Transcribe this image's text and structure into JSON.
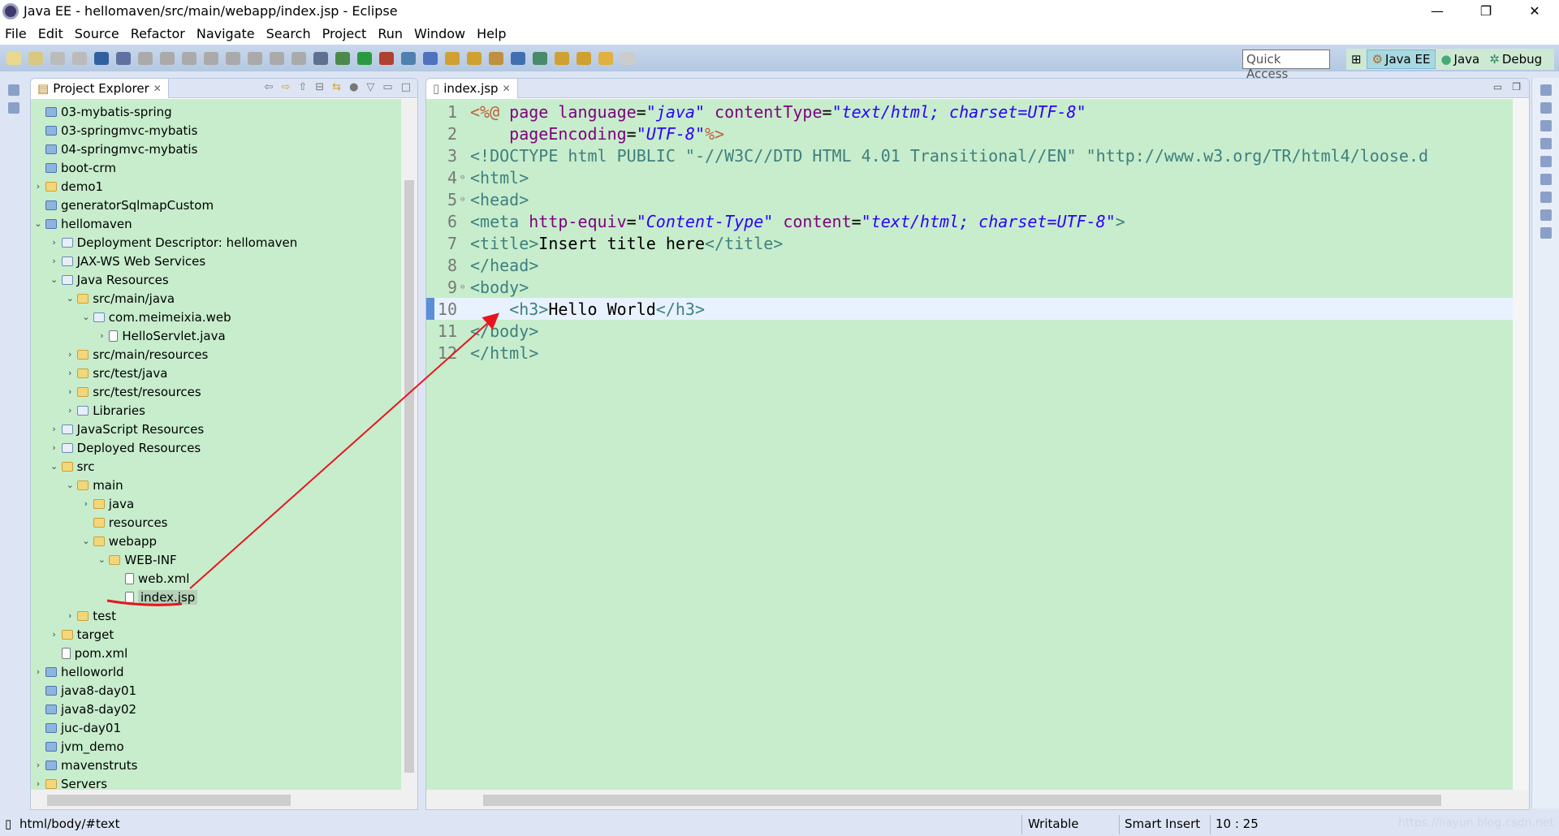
{
  "window": {
    "title": "Java EE - hellomaven/src/main/webapp/index.jsp - Eclipse",
    "controls": [
      "—",
      "❐",
      "✕"
    ]
  },
  "menu": [
    "File",
    "Edit",
    "Source",
    "Refactor",
    "Navigate",
    "Search",
    "Project",
    "Run",
    "Window",
    "Help"
  ],
  "toolbar": {
    "quick_access_placeholder": "Quick Access",
    "perspectives": [
      {
        "label": "Java EE",
        "active": true
      },
      {
        "label": "Java",
        "active": false
      },
      {
        "label": "Debug",
        "active": false
      }
    ]
  },
  "explorer": {
    "title": "Project Explorer",
    "items": [
      {
        "label": "03-mybatis-spring",
        "level": 0,
        "state": "none",
        "icon": "project-folder"
      },
      {
        "label": "03-springmvc-mybatis",
        "level": 0,
        "state": "none",
        "icon": "project-folder"
      },
      {
        "label": "04-springmvc-mybatis",
        "level": 0,
        "state": "none",
        "icon": "project-folder"
      },
      {
        "label": "boot-crm",
        "level": 0,
        "state": "none",
        "icon": "project-folder"
      },
      {
        "label": "demo1",
        "level": 0,
        "state": "collapsed",
        "icon": "folder"
      },
      {
        "label": "generatorSqlmapCustom",
        "level": 0,
        "state": "none",
        "icon": "project-folder"
      },
      {
        "label": "hellomaven",
        "level": 0,
        "state": "expanded",
        "icon": "project"
      },
      {
        "label": "Deployment Descriptor: hellomaven",
        "level": 1,
        "state": "collapsed",
        "icon": "descriptor"
      },
      {
        "label": "JAX-WS Web Services",
        "level": 1,
        "state": "collapsed",
        "icon": "web-services"
      },
      {
        "label": "Java Resources",
        "level": 1,
        "state": "expanded",
        "icon": "java-resources"
      },
      {
        "label": "src/main/java",
        "level": 2,
        "state": "expanded",
        "icon": "source-folder"
      },
      {
        "label": "com.meimeixia.web",
        "level": 3,
        "state": "expanded",
        "icon": "package"
      },
      {
        "label": "HelloServlet.java",
        "level": 4,
        "state": "collapsed",
        "icon": "java-file"
      },
      {
        "label": "src/main/resources",
        "level": 2,
        "state": "collapsed",
        "icon": "source-folder"
      },
      {
        "label": "src/test/java",
        "level": 2,
        "state": "collapsed",
        "icon": "source-folder"
      },
      {
        "label": "src/test/resources",
        "level": 2,
        "state": "collapsed",
        "icon": "source-folder"
      },
      {
        "label": "Libraries",
        "level": 2,
        "state": "collapsed",
        "icon": "libraries"
      },
      {
        "label": "JavaScript Resources",
        "level": 1,
        "state": "collapsed",
        "icon": "js-resources"
      },
      {
        "label": "Deployed Resources",
        "level": 1,
        "state": "collapsed",
        "icon": "deployed"
      },
      {
        "label": "src",
        "level": 1,
        "state": "expanded",
        "icon": "folder"
      },
      {
        "label": "main",
        "level": 2,
        "state": "expanded",
        "icon": "folder"
      },
      {
        "label": "java",
        "level": 3,
        "state": "collapsed",
        "icon": "folder"
      },
      {
        "label": "resources",
        "level": 3,
        "state": "none",
        "icon": "folder"
      },
      {
        "label": "webapp",
        "level": 3,
        "state": "expanded",
        "icon": "folder"
      },
      {
        "label": "WEB-INF",
        "level": 4,
        "state": "expanded",
        "icon": "folder"
      },
      {
        "label": "web.xml",
        "level": 5,
        "state": "none",
        "icon": "xml-file"
      },
      {
        "label": "index.jsp",
        "level": 5,
        "state": "none",
        "icon": "jsp-file",
        "selected": true
      },
      {
        "label": "test",
        "level": 2,
        "state": "collapsed",
        "icon": "folder"
      },
      {
        "label": "target",
        "level": 1,
        "state": "collapsed",
        "icon": "folder"
      },
      {
        "label": "pom.xml",
        "level": 1,
        "state": "none",
        "icon": "maven-file"
      },
      {
        "label": "helloworld",
        "level": 0,
        "state": "collapsed",
        "icon": "project"
      },
      {
        "label": "java8-day01",
        "level": 0,
        "state": "none",
        "icon": "project-folder"
      },
      {
        "label": "java8-day02",
        "level": 0,
        "state": "none",
        "icon": "project-folder"
      },
      {
        "label": "juc-day01",
        "level": 0,
        "state": "none",
        "icon": "project-folder"
      },
      {
        "label": "jvm_demo",
        "level": 0,
        "state": "none",
        "icon": "project-folder"
      },
      {
        "label": "mavenstruts",
        "level": 0,
        "state": "collapsed",
        "icon": "project"
      },
      {
        "label": "Servers",
        "level": 0,
        "state": "collapsed",
        "icon": "folder"
      }
    ]
  },
  "editor": {
    "tab": "index.jsp",
    "current_line": 10,
    "lines": [
      {
        "n": "1",
        "fold": "",
        "seg": [
          [
            "<%@ ",
            "dir"
          ],
          [
            "page ",
            "attr"
          ],
          [
            "language",
            "attr"
          ],
          [
            "=",
            "plain"
          ],
          [
            "\"java\"",
            "val"
          ],
          [
            " contentType",
            "attr"
          ],
          [
            "=",
            "plain"
          ],
          [
            "\"text/html; charset=UTF-8\"",
            "val"
          ]
        ]
      },
      {
        "n": "2",
        "fold": "",
        "seg": [
          [
            "    pageEncoding",
            "attr"
          ],
          [
            "=",
            "plain"
          ],
          [
            "\"UTF-8\"",
            "val"
          ],
          [
            "%>",
            "dir"
          ]
        ]
      },
      {
        "n": "3",
        "fold": "",
        "seg": [
          [
            "<!DOCTYPE html PUBLIC \"-//W3C//DTD HTML 4.01 Transitional//EN\" \"http://www.w3.org/TR/html4/loose.d",
            "doctype"
          ]
        ]
      },
      {
        "n": "4",
        "fold": "⊖",
        "seg": [
          [
            "<html>",
            "tag"
          ]
        ]
      },
      {
        "n": "5",
        "fold": "⊖",
        "seg": [
          [
            "<head>",
            "tag"
          ]
        ]
      },
      {
        "n": "6",
        "fold": "",
        "seg": [
          [
            "<meta ",
            "tag"
          ],
          [
            "http-equiv",
            "attr"
          ],
          [
            "=",
            "plain"
          ],
          [
            "\"Content-Type\"",
            "val"
          ],
          [
            " content",
            "attr"
          ],
          [
            "=",
            "plain"
          ],
          [
            "\"text/html; charset=UTF-8\"",
            "val"
          ],
          [
            ">",
            "tag"
          ]
        ]
      },
      {
        "n": "7",
        "fold": "",
        "seg": [
          [
            "<title>",
            "tag"
          ],
          [
            "Insert title here",
            "plain"
          ],
          [
            "</title>",
            "tag"
          ]
        ]
      },
      {
        "n": "8",
        "fold": "",
        "seg": [
          [
            "</head>",
            "tag"
          ]
        ]
      },
      {
        "n": "9",
        "fold": "⊖",
        "seg": [
          [
            "<body>",
            "tag"
          ]
        ]
      },
      {
        "n": "10",
        "fold": "",
        "seg": [
          [
            "    <h3>",
            "tag"
          ],
          [
            "Hello World",
            "plain"
          ],
          [
            "</h3>",
            "tag"
          ]
        ]
      },
      {
        "n": "11",
        "fold": "",
        "seg": [
          [
            "</body>",
            "tag"
          ]
        ]
      },
      {
        "n": "12",
        "fold": "",
        "seg": [
          [
            "</html>",
            "tag"
          ]
        ]
      }
    ]
  },
  "status": {
    "path": "html/body/#text",
    "writable": "Writable",
    "insert_mode": "Smart Insert",
    "position": "10 : 25",
    "watermark": "https://liayun.blog.csdn.net"
  },
  "colors": {
    "editor_bg": "#c7edcc",
    "annotation": "#e8141e"
  }
}
